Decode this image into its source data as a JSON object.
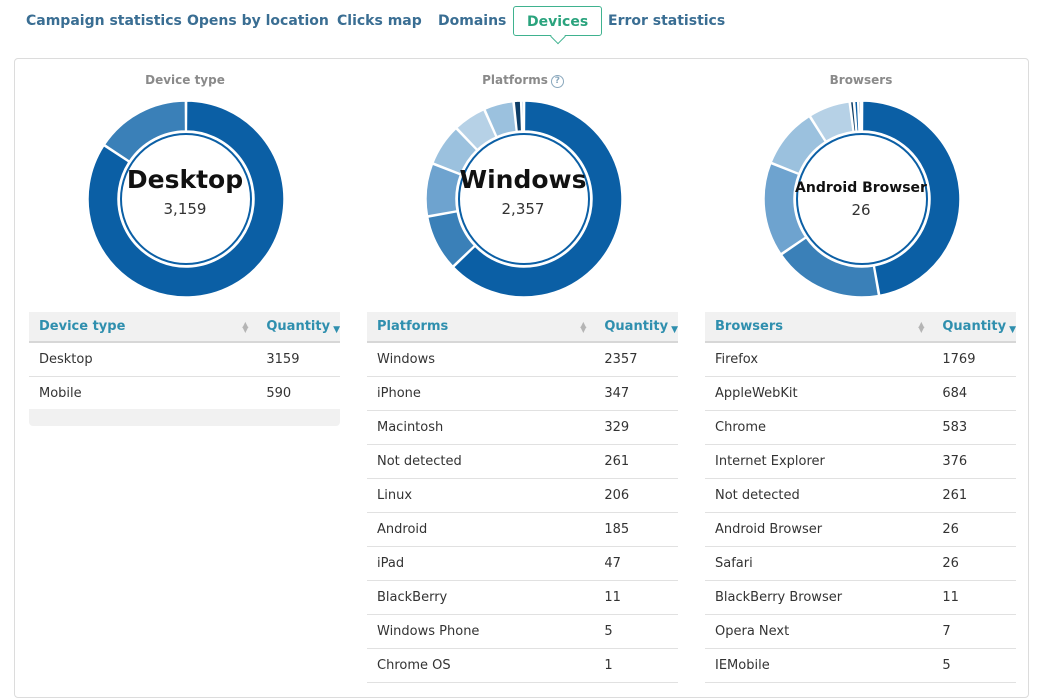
{
  "tabs": [
    {
      "label": "Campaign statistics",
      "active": false
    },
    {
      "label": "Opens by location",
      "active": false
    },
    {
      "label": "Clicks map",
      "active": false
    },
    {
      "label": "Domains",
      "active": false
    },
    {
      "label": "Devices",
      "active": true
    },
    {
      "label": "Error statistics",
      "active": false
    }
  ],
  "device": {
    "title": "Device type",
    "center_label": "Desktop",
    "center_value": "3,159",
    "col_name": "Device type",
    "col_qty": "Quantity",
    "rows": [
      {
        "name": "Desktop",
        "qty": "3159"
      },
      {
        "name": "Mobile",
        "qty": "590"
      }
    ]
  },
  "platforms": {
    "title": "Platforms",
    "help_icon": "?",
    "center_label": "Windows",
    "center_value": "2,357",
    "col_name": "Platforms",
    "col_qty": "Quantity",
    "rows": [
      {
        "name": "Windows",
        "qty": "2357"
      },
      {
        "name": "iPhone",
        "qty": "347"
      },
      {
        "name": "Macintosh",
        "qty": "329"
      },
      {
        "name": "Not detected",
        "qty": "261"
      },
      {
        "name": "Linux",
        "qty": "206"
      },
      {
        "name": "Android",
        "qty": "185"
      },
      {
        "name": "iPad",
        "qty": "47"
      },
      {
        "name": "BlackBerry",
        "qty": "11"
      },
      {
        "name": "Windows Phone",
        "qty": "5"
      },
      {
        "name": "Chrome OS",
        "qty": "1"
      }
    ]
  },
  "browsers": {
    "title": "Browsers",
    "center_label": "Android Browser",
    "center_value": "26",
    "col_name": "Browsers",
    "col_qty": "Quantity",
    "rows": [
      {
        "name": "Firefox",
        "qty": "1769"
      },
      {
        "name": "AppleWebKit",
        "qty": "684"
      },
      {
        "name": "Chrome",
        "qty": "583"
      },
      {
        "name": "Internet Explorer",
        "qty": "376"
      },
      {
        "name": "Not detected",
        "qty": "261"
      },
      {
        "name": "Android Browser",
        "qty": "26"
      },
      {
        "name": "Safari",
        "qty": "26"
      },
      {
        "name": "BlackBerry Browser",
        "qty": "11"
      },
      {
        "name": "Opera Next",
        "qty": "7"
      },
      {
        "name": "IEMobile",
        "qty": "5"
      }
    ]
  },
  "colors": {
    "dark": "#0b5fa5",
    "mid": "#3a80b8",
    "light": "#6ea3cf",
    "pale": "#9bc1de",
    "paler": "#b6d1e6",
    "navy": "#0d3d66"
  }
}
